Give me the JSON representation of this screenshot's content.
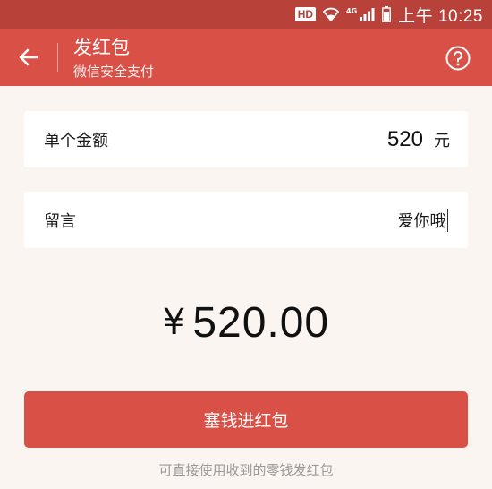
{
  "status_bar": {
    "hd_label": "HD",
    "network_label": "4G",
    "time": "上午 10:25",
    "icons": [
      "wifi-icon",
      "signal-icon",
      "battery-icon"
    ]
  },
  "header": {
    "title": "发红包",
    "subtitle": "微信安全支付",
    "back_icon": "arrow-left-icon",
    "help_icon": "question-circle-icon"
  },
  "amount_field": {
    "label": "单个金额",
    "value": "520",
    "unit": "元"
  },
  "message_field": {
    "label": "留言",
    "value": "爱你哦"
  },
  "total": {
    "currency": "¥",
    "amount": "520.00"
  },
  "submit_button": {
    "label": "塞钱进红包"
  },
  "hint": "可直接使用收到的零钱发红包",
  "colors": {
    "status_bar": "#b8413a",
    "header": "#d95047",
    "button": "#d95047",
    "background": "#faf5f0"
  }
}
